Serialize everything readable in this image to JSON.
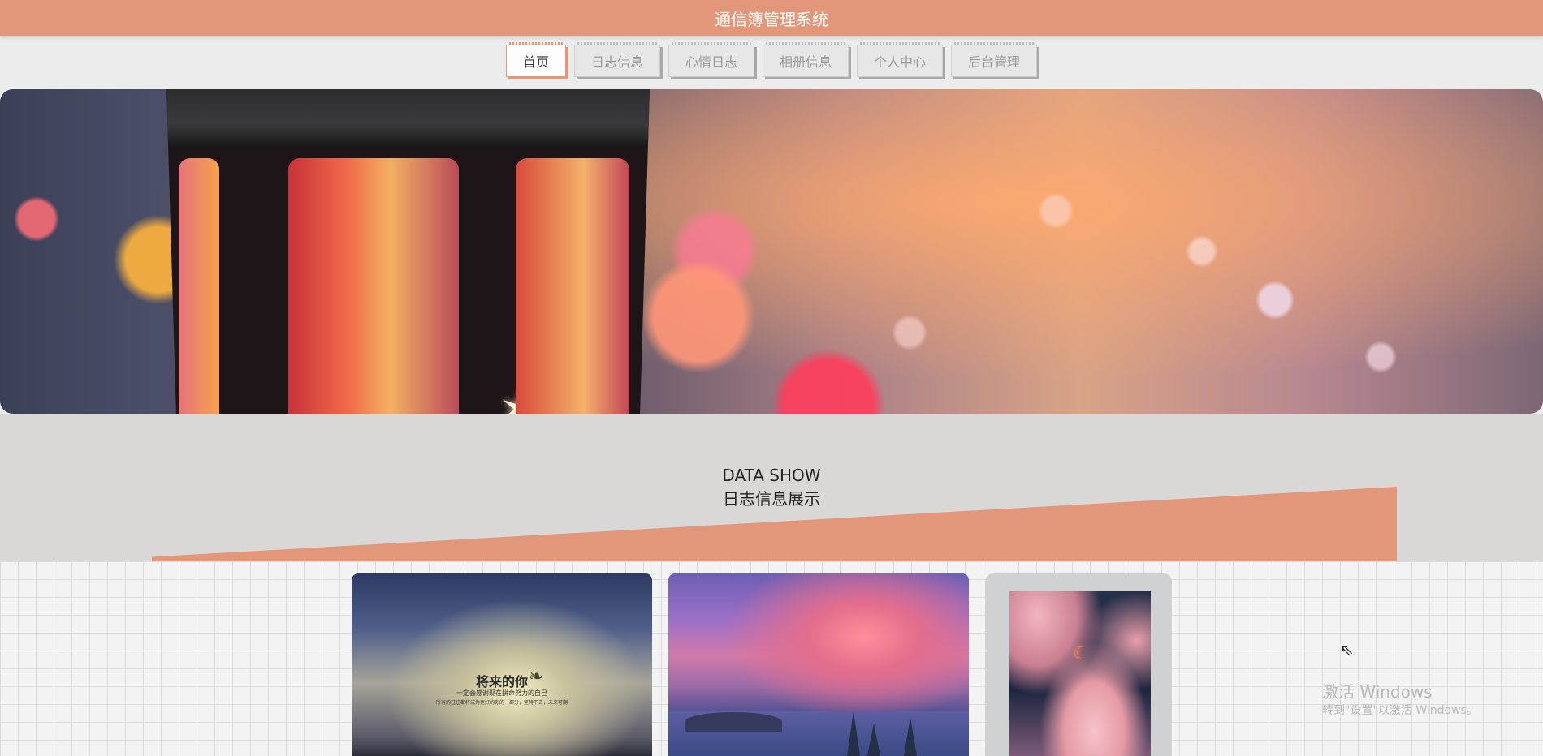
{
  "header": {
    "title": "通信簿管理系统"
  },
  "nav": {
    "items": [
      {
        "label": "首页",
        "active": true
      },
      {
        "label": "日志信息"
      },
      {
        "label": "心情日志"
      },
      {
        "label": "相册信息"
      },
      {
        "label": "个人中心"
      },
      {
        "label": "后台管理"
      }
    ]
  },
  "section": {
    "title_en": "DATA SHOW",
    "title_cn": "日志信息展示"
  },
  "cards": [
    {
      "title": "将来的你",
      "subtitle": "一定会感谢现在拼命努力的自己",
      "tiny": "所有的过往都将成为更好的你的一部分，坚持下去，未来可期"
    },
    {
      "title": ""
    },
    {
      "title": ""
    }
  ],
  "watermark": {
    "line1": "激活 Windows",
    "line2": "转到\"设置\"以激活 Windows。"
  },
  "colors": {
    "accent": "#e2977b",
    "background": "#ececec",
    "section_bg": "#dad7d7"
  },
  "icons": [
    "bird-icon",
    "moon-icon",
    "star-icon",
    "cursor-icon"
  ]
}
